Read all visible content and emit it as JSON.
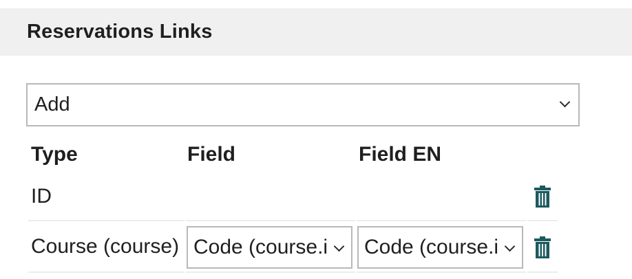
{
  "section": {
    "title": "Reservations Links"
  },
  "add_select": {
    "value": "Add",
    "icon": "chevron-down-icon"
  },
  "table": {
    "headers": [
      "Type",
      "Field",
      "Field EN"
    ],
    "rows": [
      {
        "type": "ID",
        "field": "",
        "field_en": "",
        "delete_icon": "trash-icon"
      },
      {
        "type": "Course (course)",
        "field": "Code (course.i",
        "field_en": "Code (course.i",
        "delete_icon": "trash-icon"
      }
    ]
  },
  "colors": {
    "header_bg": "#f0f0f0",
    "trash_icon": "#1b5a5e",
    "border": "#b8b8b8"
  }
}
